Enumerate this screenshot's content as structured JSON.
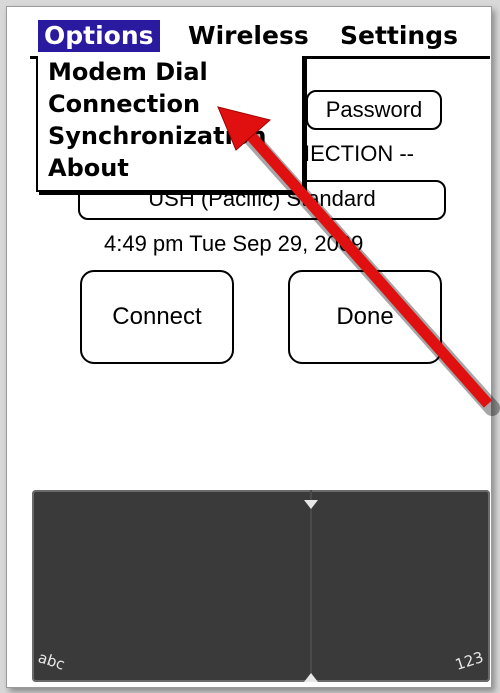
{
  "menubar": {
    "options": "Options",
    "wireless": "Wireless",
    "settings": "Settings"
  },
  "dropdown": {
    "items": [
      "Modem Dial",
      "Connection",
      "Synchronization",
      "About"
    ]
  },
  "form": {
    "password_button": "Password",
    "connection_label": "IECTION --",
    "timezone": "USH (Pacific) Standard",
    "datetime": "4:49 pm Tue Sep 29, 2009"
  },
  "buttons": {
    "connect": "Connect",
    "done": "Done"
  },
  "graffiti": {
    "left_label": "abc",
    "right_label": "123"
  },
  "colors": {
    "menu_highlight": "#2a1aa0",
    "annotation_arrow": "#e01010"
  }
}
